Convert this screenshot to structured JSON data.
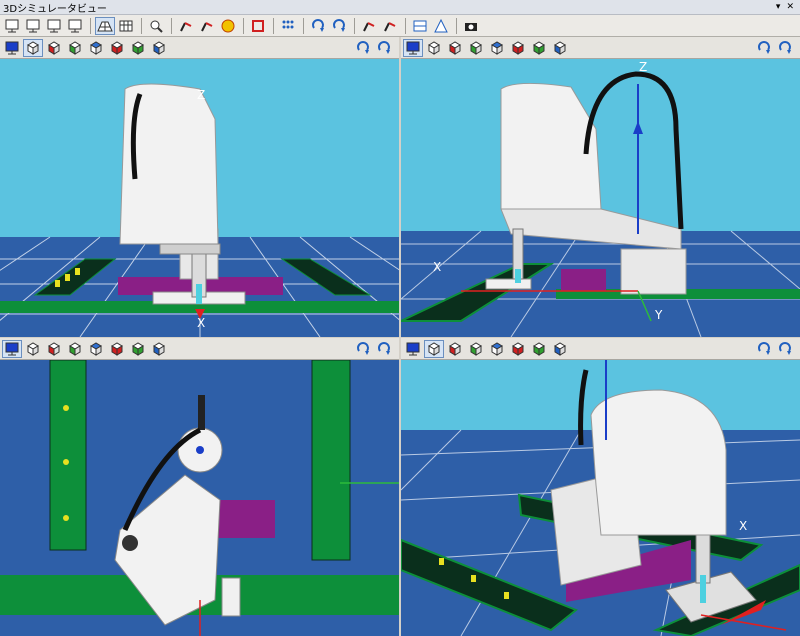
{
  "window": {
    "title": "3Dシミュレータビュー",
    "pin_glyph": "▾",
    "close_glyph": "✕"
  },
  "toolbar": {
    "groups": [
      [
        "monitor-icon-1",
        "monitor-icon-2",
        "monitor-icon-3",
        "monitor-icon-4"
      ],
      [
        "grid-floor-icon",
        "table-icon"
      ],
      [
        "part-add-icon"
      ],
      [
        "robot-arm-icon-1",
        "robot-arm-icon-2",
        "sphere-icon"
      ],
      [
        "box-outline-icon"
      ],
      [
        "points-icon"
      ],
      [
        "rotate-icon-1",
        "rotate-icon-2"
      ],
      [
        "robot-move-icon-1",
        "robot-move-icon-2"
      ],
      [
        "layout-icon",
        "triangle-icon"
      ],
      [
        "camera-icon"
      ]
    ]
  },
  "viewports": [
    {
      "id": "top-left",
      "axis_labels": [
        "Z",
        "X"
      ]
    },
    {
      "id": "top-right",
      "axis_labels": [
        "Z",
        "X",
        "Y"
      ]
    },
    {
      "id": "bottom-left",
      "axis_labels": []
    },
    {
      "id": "bottom-right",
      "axis_labels": [
        "X"
      ]
    }
  ],
  "view_buttons": [
    "display-icon",
    "cube-wire-icon",
    "cube-red-front-icon",
    "cube-green-icon",
    "cube-top-icon",
    "cube-red-side-icon",
    "cube-green-side-icon",
    "cube-blue-icon"
  ],
  "colors": {
    "sky": "#5bc3e0",
    "floor": "#2e5fa8",
    "grid": "#e8eef8",
    "table": "#0d8f3a",
    "table_dark": "#0a2f1c",
    "block": "#8a1f86",
    "robot": "#f2f2f2",
    "cable": "#111111",
    "axis_red": "#e02020",
    "axis_blue": "#1a3ec8",
    "axis_green": "#2dbb3a"
  }
}
